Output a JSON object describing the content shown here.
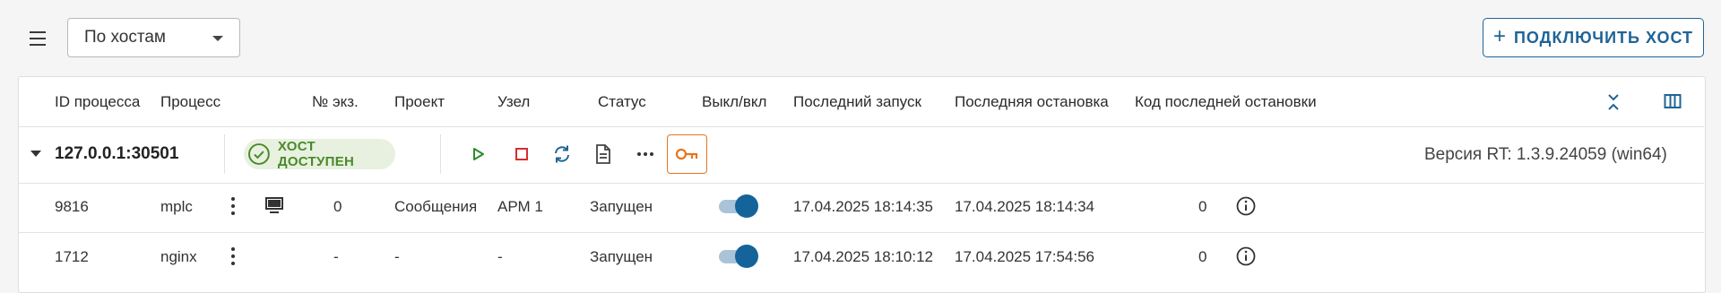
{
  "toolbar": {
    "group_select_value": "По хостам",
    "connect_button_label": "ПОДКЛЮЧИТЬ ХОСТ"
  },
  "table": {
    "headers": [
      "ID процесса",
      "Процесс",
      "№ экз.",
      "Проект",
      "Узел",
      "Статус",
      "Выкл/вкл",
      "Последний запуск",
      "Последняя остановка",
      "Код последней остановки"
    ],
    "host": {
      "address": "127.0.0.1:30501",
      "status_label": "ХОСТ ДОСТУПЕН",
      "version": "Версия RT: 1.3.9.24059 (win64)"
    },
    "rows": [
      {
        "pid": "9816",
        "process": "mplc",
        "instance": "0",
        "project": "Сообщения",
        "node": "АРМ 1",
        "status": "Запущен",
        "enabled": true,
        "last_start": "17.04.2025 18:14:35",
        "last_stop": "17.04.2025 18:14:34",
        "stop_code": "0"
      },
      {
        "pid": "1712",
        "process": "nginx",
        "instance": "-",
        "project": "-",
        "node": "-",
        "status": "Запущен",
        "enabled": true,
        "last_start": "17.04.2025 18:10:12",
        "last_stop": "17.04.2025 17:54:56",
        "stop_code": "0"
      }
    ]
  },
  "icons": [
    "menu-icon",
    "chevron-down-icon",
    "plus-icon",
    "collapse-all-icon",
    "columns-icon",
    "expand-caret-icon",
    "check-circle-icon",
    "play-icon",
    "stop-icon",
    "restart-icon",
    "document-icon",
    "more-horizontal-icon",
    "key-icon",
    "more-vertical-icon",
    "monitor-icon",
    "info-icon"
  ],
  "colors": {
    "accent": "#1f6496",
    "host_ok_text": "#4a8a2a",
    "host_ok_bg": "#e8f1e0",
    "play": "#2e8b2e",
    "stop": "#d32f2f",
    "key": "#e8741d",
    "toggle_on": "#14639a"
  }
}
